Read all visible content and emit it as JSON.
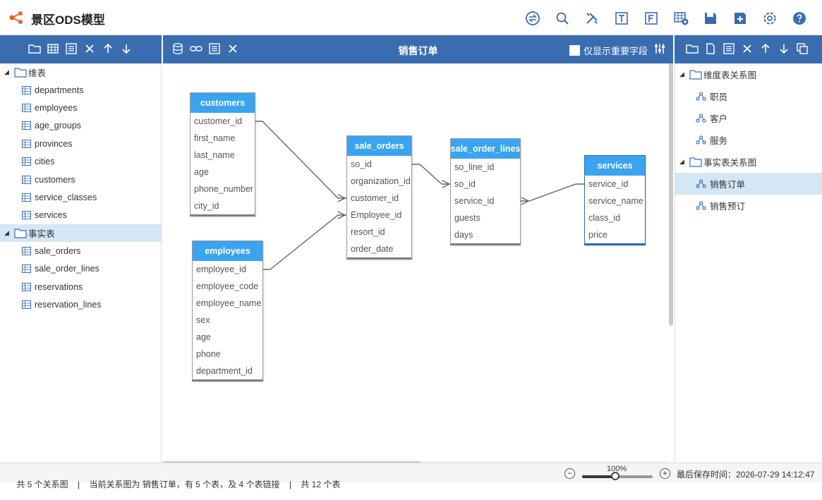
{
  "app": {
    "title": "景区ODS模型"
  },
  "toolbar": {
    "icons": [
      "exchange-icon",
      "search-icon",
      "tools-icon",
      "text-t-icon",
      "text-f-icon",
      "add-table-icon",
      "save-icon",
      "save-as-icon",
      "settings-icon",
      "help-icon"
    ]
  },
  "left_tree": {
    "groups": [
      {
        "label": "维表",
        "items": [
          "departments",
          "employees",
          "age_groups",
          "provinces",
          "cities",
          "customers",
          "service_classes",
          "services"
        ]
      },
      {
        "label": "事实表",
        "items": [
          "sale_orders",
          "sale_order_lines",
          "reservations",
          "reservation_lines"
        ]
      }
    ]
  },
  "center": {
    "title": "销售订单",
    "important_fields_label": "仅显示重要字段"
  },
  "entities": {
    "customers": {
      "name": "customers",
      "fields": [
        "customer_id",
        "first_name",
        "last_name",
        "age",
        "phone_number",
        "city_id"
      ]
    },
    "employees": {
      "name": "employees",
      "fields": [
        "employee_id",
        "employee_code",
        "employee_name",
        "sex",
        "age",
        "phone",
        "department_id"
      ]
    },
    "sale_orders": {
      "name": "sale_orders",
      "fields": [
        "so_id",
        "organization_id",
        "customer_id",
        "Employee_id",
        "resort_id",
        "order_date"
      ]
    },
    "sale_order_lines": {
      "name": "sale_order_lines",
      "fields": [
        "so_line_id",
        "so_id",
        "service_id",
        "guests",
        "days"
      ]
    },
    "services": {
      "name": "services",
      "fields": [
        "service_id",
        "service_name",
        "class_id",
        "price"
      ]
    }
  },
  "right_tree": {
    "groups": [
      {
        "label": "维度表关系图",
        "items": [
          "职员",
          "客户",
          "服务"
        ]
      },
      {
        "label": "事实表关系图",
        "items": [
          "销售订单",
          "销售预订"
        ]
      }
    ],
    "selected": "销售订单"
  },
  "status": {
    "diagrams": "共 5 个关系图",
    "current": "当前关系图为 销售订单，有 5 个表，及 4 个表链接",
    "tables": "共 12 个表",
    "zoom_label": "100%",
    "zoom_value": 0.47,
    "saved": "最后保存时间：2026-07-29 14:12:47"
  },
  "colors": {
    "accent_bar": "#3a6db0",
    "entity_header": "#3aa4f0",
    "selected_bg": "#d4e7f6"
  }
}
